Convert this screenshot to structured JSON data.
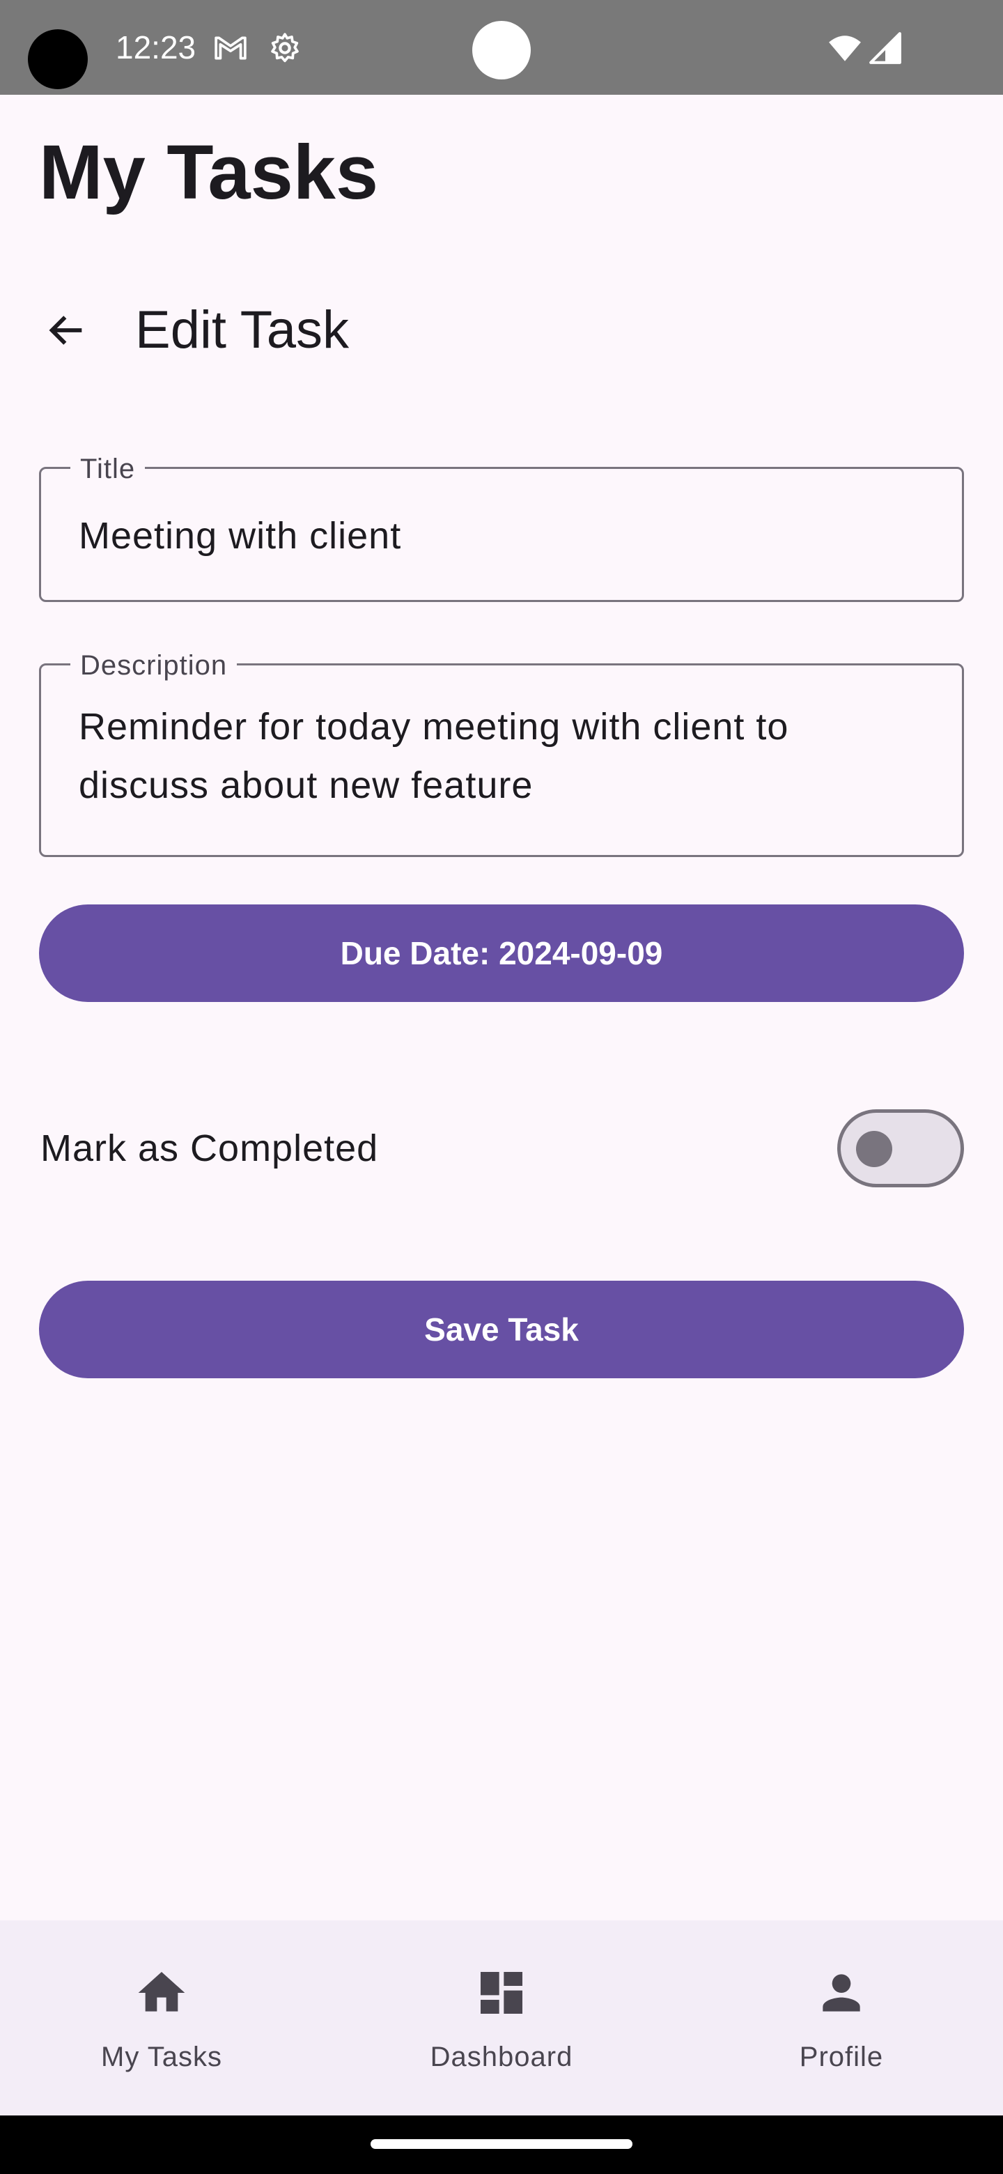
{
  "status_bar": {
    "time": "12:23",
    "icons": [
      "gmail-icon",
      "settings-gear-icon",
      "wifi-icon",
      "cellular-signal-icon"
    ]
  },
  "app": {
    "title": "My Tasks"
  },
  "screen": {
    "title": "Edit Task",
    "back_icon": "arrow-back-icon"
  },
  "form": {
    "title_field": {
      "label": "Title",
      "value": "Meeting with client"
    },
    "description_field": {
      "label": "Description",
      "value": "Reminder for today meeting with client to discuss about new feature"
    },
    "due_date_button": "Due Date: 2024-09-09",
    "completed_switch": {
      "label": "Mark as Completed",
      "checked": false
    },
    "save_button": "Save Task"
  },
  "bottom_nav": {
    "items": [
      {
        "label": "My Tasks",
        "icon": "home-icon"
      },
      {
        "label": "Dashboard",
        "icon": "dashboard-icon"
      },
      {
        "label": "Profile",
        "icon": "person-icon"
      }
    ]
  },
  "colors": {
    "primary": "#6750a4",
    "background": "#fdf7fc",
    "nav_background": "#f3edf7",
    "outline": "#79747e",
    "status_bar": "#797979"
  }
}
